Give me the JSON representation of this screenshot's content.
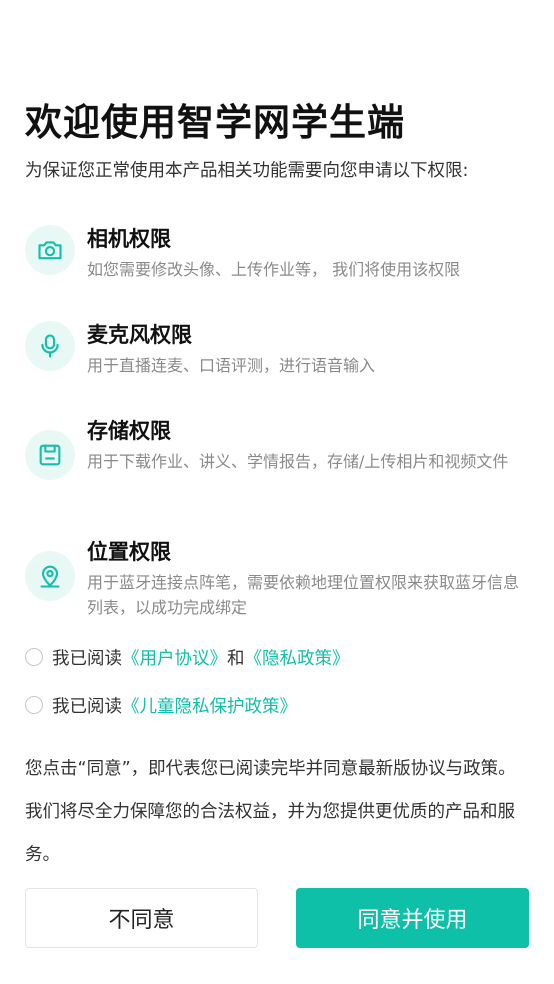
{
  "title": "欢迎使用智学网学生端",
  "subtitle": "为保证您正常使用本产品相关功能需要向您申请以下权限:",
  "permissions": [
    {
      "title": "相机权限",
      "desc": "如您需要修改头像、上传作业等， 我们将使用该权限",
      "icon": "camera-icon"
    },
    {
      "title": "麦克风权限",
      "desc": "用于直播连麦、口语评测，进行语音输入",
      "icon": "microphone-icon"
    },
    {
      "title": "存储权限",
      "desc": "用于下载作业、讲义、学情报告，存储/上传相片和视频文件",
      "icon": "storage-icon"
    },
    {
      "title": "位置权限",
      "desc": "用于蓝牙连接点阵笔，需要依赖地理位置权限来获取蓝牙信息列表，以成功完成绑定",
      "icon": "location-icon"
    }
  ],
  "agreements": [
    {
      "prefix": "我已阅读",
      "link1": "《用户协议》",
      "middle": "和",
      "link2": "《隐私政策》"
    },
    {
      "prefix": "我已阅读",
      "link1": "《儿童隐私保护政策》"
    }
  ],
  "notice": "您点击“同意”，即代表您已阅读完毕并同意最新版协议与政策。我们将尽全力保障您的合法权益，并为您提供更优质的产品和服务。",
  "buttons": {
    "decline": "不同意",
    "accept": "同意并使用"
  },
  "colors": {
    "accent": "#0fc0a9",
    "icon_bg": "#e8f8f5"
  }
}
